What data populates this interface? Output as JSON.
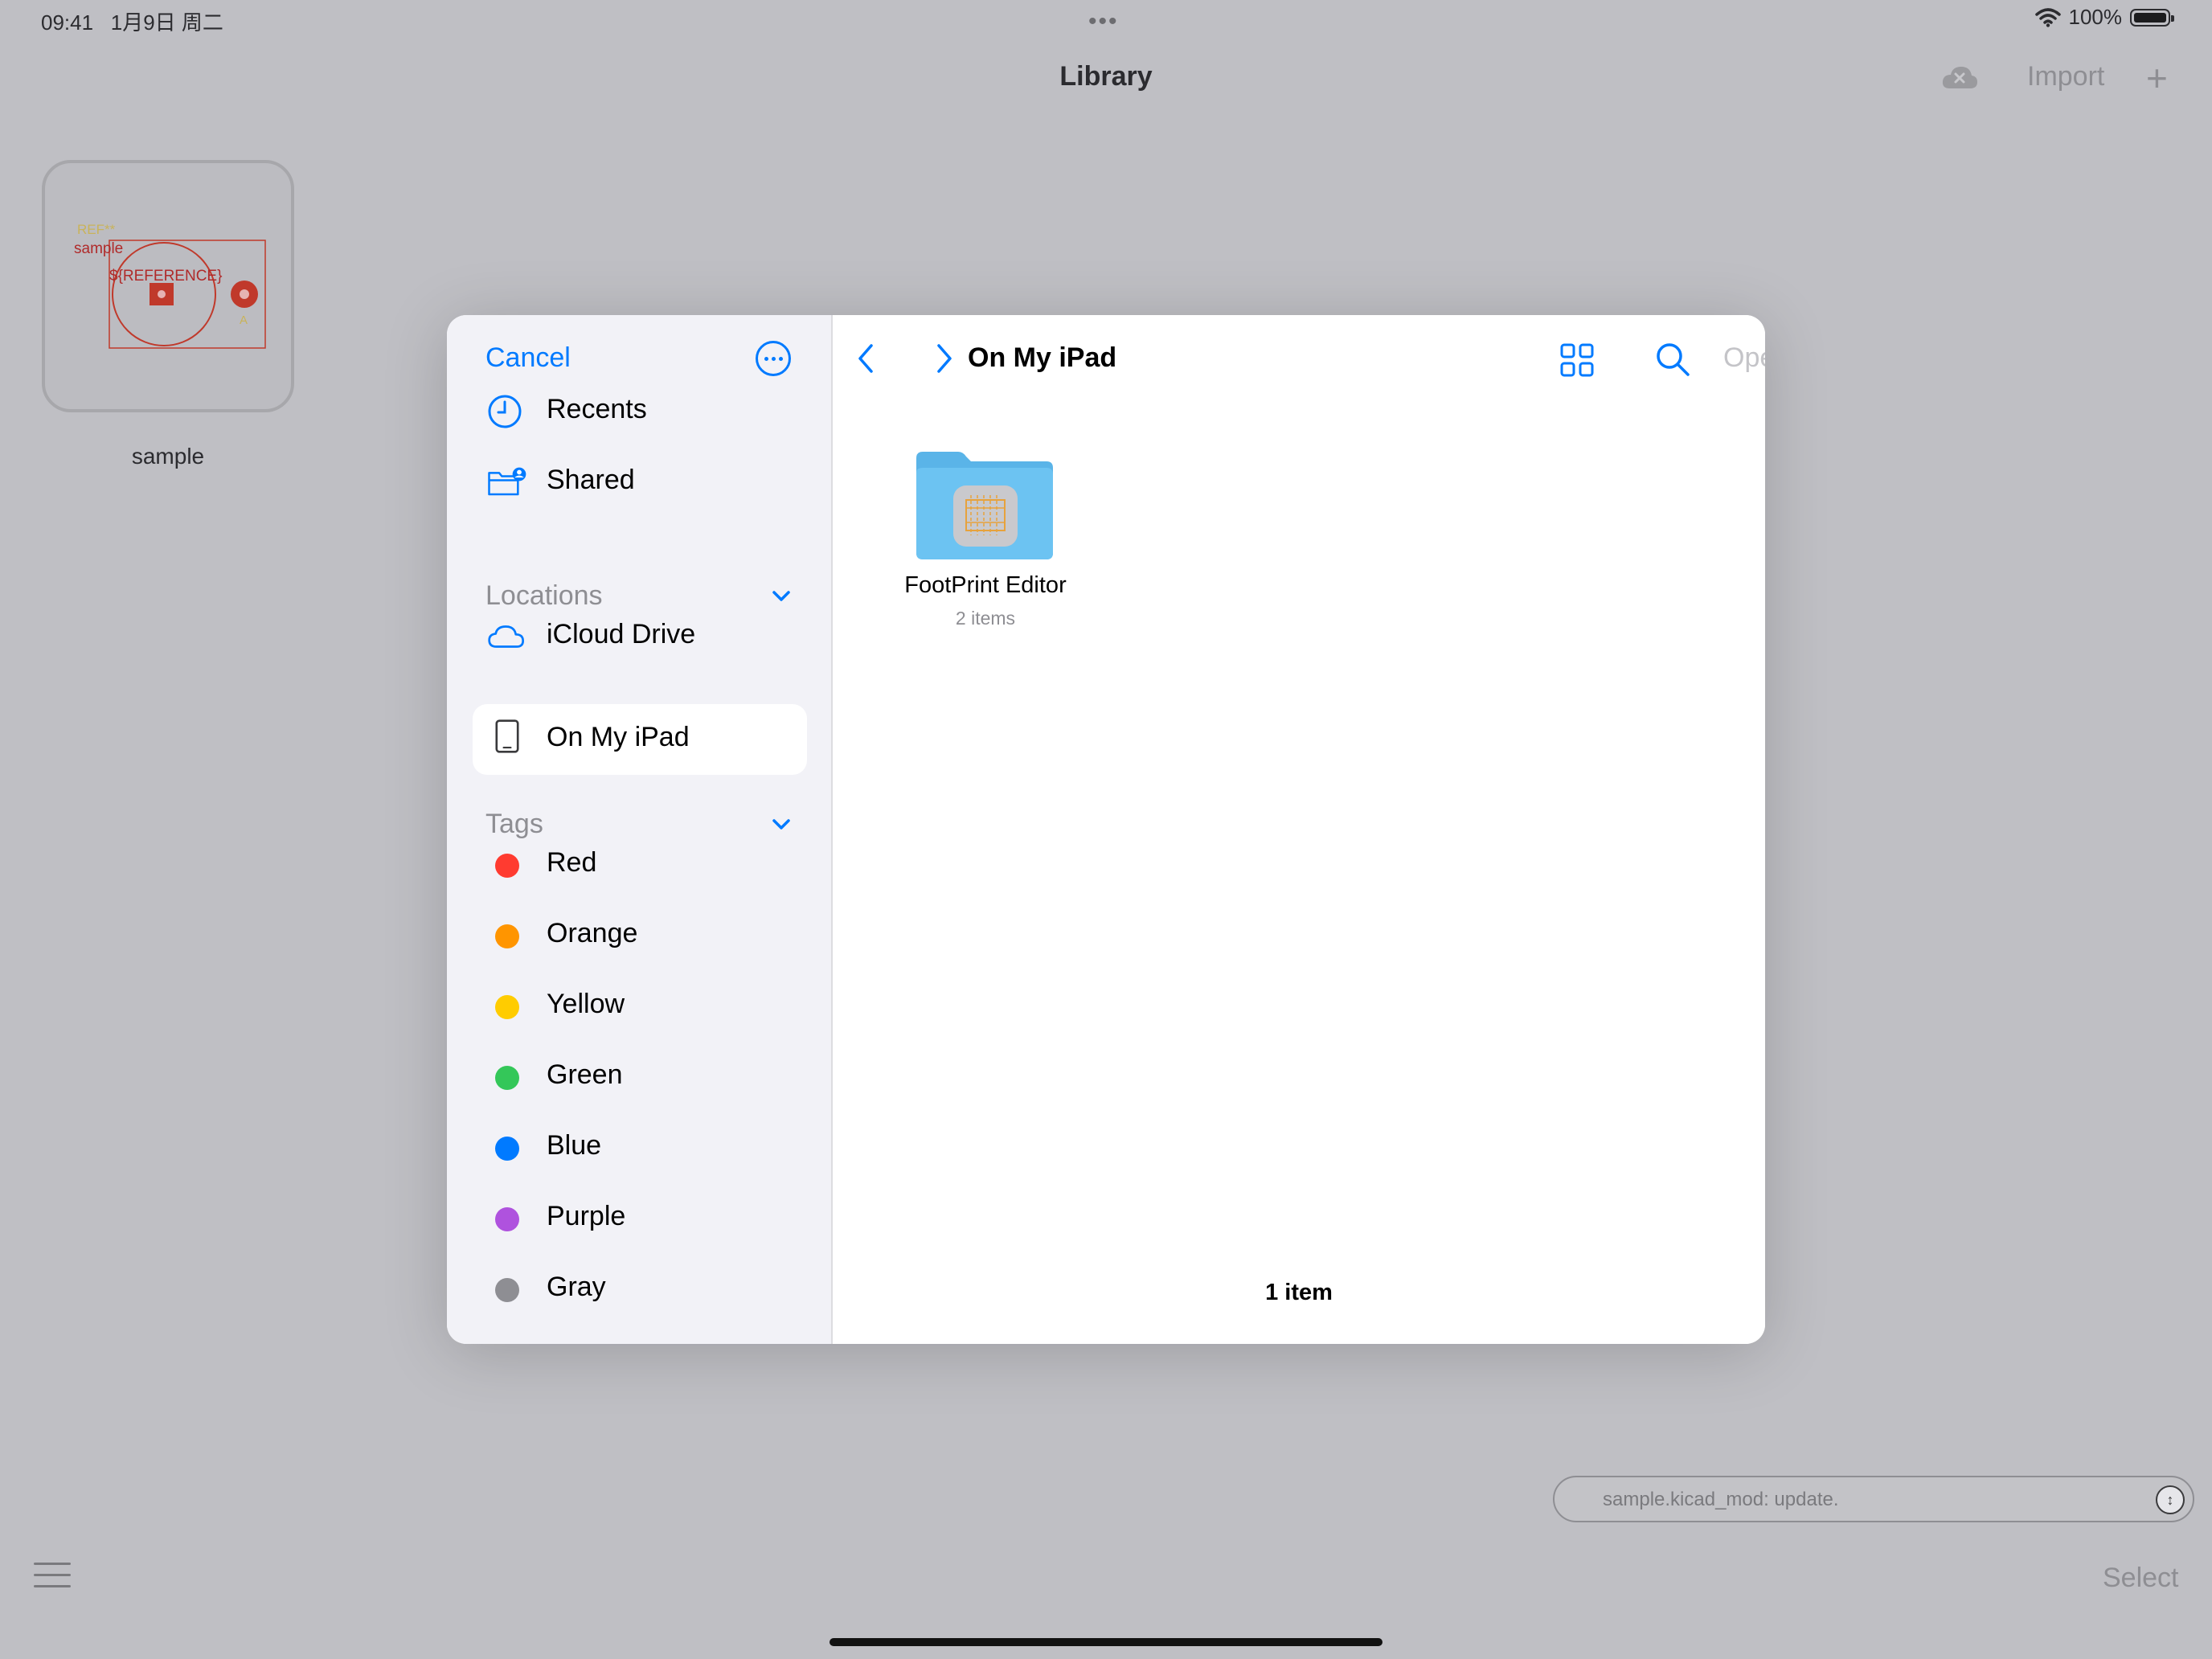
{
  "status": {
    "time": "09:41",
    "date": "1月9日 周二",
    "battery": "100%"
  },
  "nav": {
    "title": "Library",
    "import_label": "Import",
    "add_label": "+"
  },
  "library": {
    "items": [
      {
        "name": "sample",
        "preview_texts": [
          "REF**",
          "sample",
          "${REFERENCE}",
          "A"
        ]
      }
    ]
  },
  "bottom": {
    "select_label": "Select",
    "message": "sample.kicad_mod: update."
  },
  "picker": {
    "cancel_label": "Cancel",
    "sidebar": {
      "favorites": [
        {
          "label": "Recents",
          "icon": "clock-icon"
        },
        {
          "label": "Shared",
          "icon": "shared-folder-icon"
        }
      ],
      "locations_header": "Locations",
      "locations": [
        {
          "label": "iCloud Drive",
          "icon": "cloud-icon"
        },
        {
          "label": "On My iPad",
          "icon": "ipad-icon",
          "selected": true
        }
      ],
      "tags_header": "Tags",
      "tags": [
        {
          "label": "Red",
          "color": "#ff3b30"
        },
        {
          "label": "Orange",
          "color": "#ff9500"
        },
        {
          "label": "Yellow",
          "color": "#ffcc00"
        },
        {
          "label": "Green",
          "color": "#34c759"
        },
        {
          "label": "Blue",
          "color": "#007aff"
        },
        {
          "label": "Purple",
          "color": "#af52de"
        },
        {
          "label": "Gray",
          "color": "#8e8e93"
        }
      ]
    },
    "content": {
      "breadcrumb": "On My iPad",
      "open_label": "Open",
      "folders": [
        {
          "name": "FootPrint Editor",
          "count": "2 items"
        }
      ],
      "footer_count": "1 item"
    }
  },
  "colors": {
    "accent": "#007aff",
    "backdrop": "#bfbfc4",
    "folder": "#5ac8fa"
  }
}
